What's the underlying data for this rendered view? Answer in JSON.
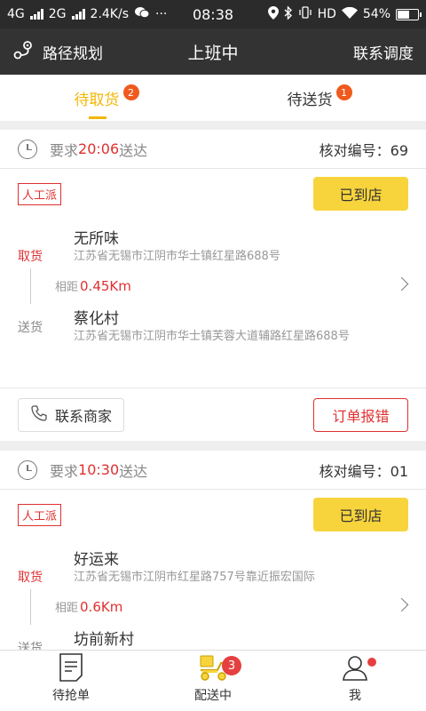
{
  "status": {
    "network1": "4G",
    "network2": "2G",
    "speed": "2.4K/s",
    "more": "···",
    "time": "08:38",
    "hd": "HD",
    "battery": "54%"
  },
  "header": {
    "route_label": "路径规划",
    "title": "上班中",
    "contact_label": "联系调度"
  },
  "tabs": [
    {
      "label": "待取货",
      "badge": "2",
      "active": true
    },
    {
      "label": "待送货",
      "badge": "1",
      "active": false
    }
  ],
  "orders": [
    {
      "require_prefix": "要求",
      "deliver_time": "20:06",
      "require_suffix": "送达",
      "verify_label": "核对编号：",
      "verify_no": "69",
      "tag": "人工派",
      "arrived_label": "已到店",
      "pick_label": "取货",
      "send_label": "送货",
      "shop_name": "无所味",
      "shop_address": "江苏省无锡市江阴市华士镇红星路688号",
      "distance_label": "相距",
      "distance": "0.45Km",
      "customer_name": "蔡化村",
      "customer_address": "江苏省无锡市江阴市华士镇芙蓉大道辅路红星路688号",
      "contact_shop_label": "联系商家",
      "report_label": "订单报错"
    },
    {
      "require_prefix": "要求",
      "deliver_time": "10:30",
      "require_suffix": "送达",
      "verify_label": "核对编号：",
      "verify_no": "01",
      "tag": "人工派",
      "arrived_label": "已到店",
      "pick_label": "取货",
      "send_label": "送货",
      "shop_name": "好运来",
      "shop_address": "江苏省无锡市江阴市红星路757号靠近振宏国际",
      "distance_label": "相距",
      "distance": "0.6Km",
      "customer_name": "坊前新村"
    }
  ],
  "bottom_nav": [
    {
      "label": "待抢单",
      "icon": "document-icon"
    },
    {
      "label": "配送中",
      "icon": "scooter-icon",
      "badge": "3"
    },
    {
      "label": "我",
      "icon": "person-icon"
    }
  ],
  "colors": {
    "accent": "#f2b705",
    "button_yellow": "#f8d43c",
    "alert_red": "#e03030",
    "header_dark": "#333333"
  }
}
